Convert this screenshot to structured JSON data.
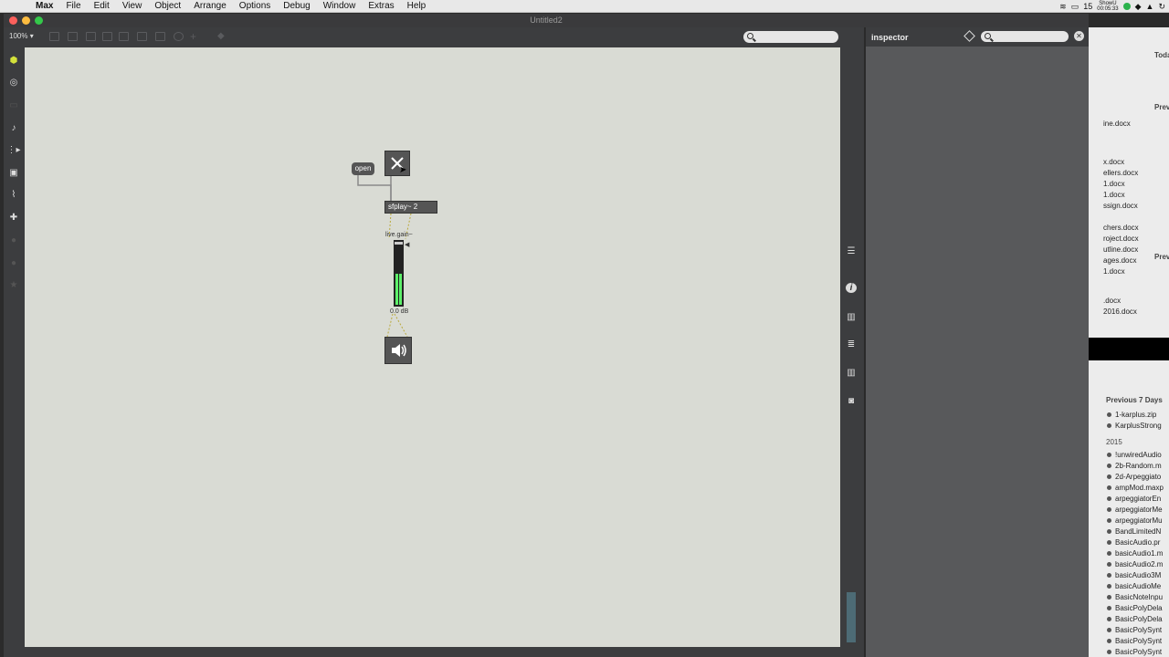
{
  "menubar": {
    "app_name": "Max",
    "items": [
      "File",
      "Edit",
      "View",
      "Object",
      "Arrange",
      "Options",
      "Debug",
      "Window",
      "Extras",
      "Help"
    ],
    "status": {
      "day": "15",
      "clock_top": "ShowU",
      "clock_bottom": "00:05:33"
    }
  },
  "window": {
    "title": "Untitled2",
    "zoom": "100%"
  },
  "patch": {
    "open_label": "open",
    "sfplay_label": "sfplay~ 2",
    "gain_label": "live.gain~",
    "gain_value": "0.0 dB",
    "gain_level": 0.5
  },
  "inspector": {
    "title": "inspector"
  },
  "finder": {
    "header_today": "Toda",
    "prev_label_1": "Prev",
    "prev_label_2": "Prev",
    "upper_files": [
      "ine.docx",
      "x.docx",
      "ellers.docx",
      "1.docx",
      "1.docx",
      "ssign.docx",
      "chers.docx",
      "roject.docx",
      "utline.docx",
      "ages.docx",
      "1.docx",
      ".docx",
      "2016.docx"
    ],
    "section_prev7": "Previous 7 Days",
    "prev7_files": [
      "1-karplus.zip",
      "KarplusStrong"
    ],
    "section_year": "2015",
    "year_files": [
      "!unwiredAudio",
      "2b-Random.m",
      "2d-Arpeggiato",
      "ampMod.maxp",
      "arpeggiatorEn",
      "arpeggiatorMe",
      "arpeggiatorMu",
      "BandLimitedN",
      "BasicAudio.pr",
      "basicAudio1.m",
      "basicAudio2.m",
      "basicAudio3M",
      "basicAudioMe",
      "BasicNoteInpu",
      "BasicPolyDela",
      "BasicPolyDela",
      "BasicPolySynt",
      "BasicPolySynt",
      "BasicPolySynt"
    ]
  },
  "colors": {
    "canvas": "#d9dbd4",
    "chrome": "#3c3d3f",
    "meter": "#5df06a",
    "inspector_bg": "#58595b"
  }
}
